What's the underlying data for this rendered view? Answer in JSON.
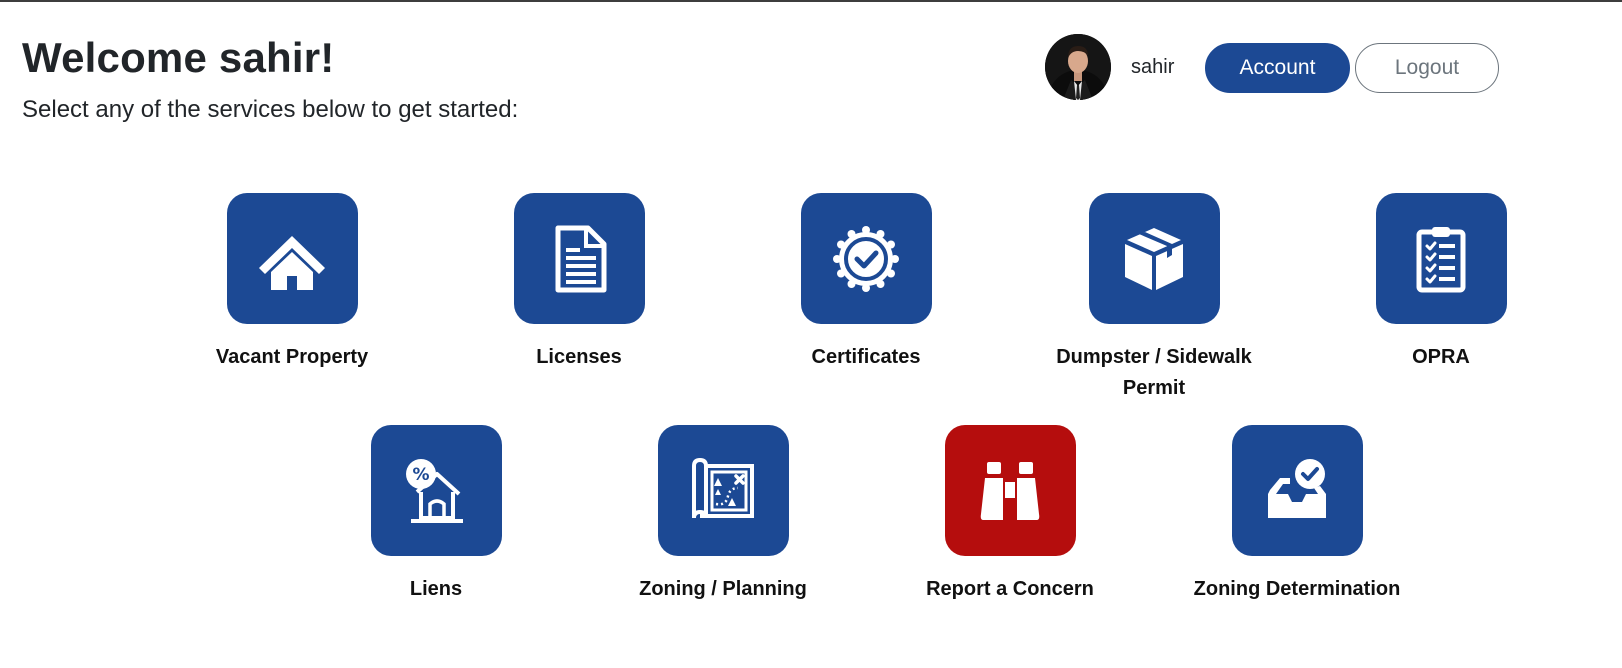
{
  "header": {
    "title": "Welcome sahir!",
    "subtitle": "Select any of the services below to get started:"
  },
  "user": {
    "name": "sahir",
    "avatar_icon": "user-avatar-photo"
  },
  "buttons": {
    "account_label": "Account",
    "logout_label": "Logout"
  },
  "colors": {
    "primary": "#1c4994",
    "alert": "#b50d0d"
  },
  "services": [
    {
      "label": "Vacant Property",
      "icon": "house-icon"
    },
    {
      "label": "Licenses",
      "icon": "document-icon"
    },
    {
      "label": "Certificates",
      "icon": "certificate-badge-icon"
    },
    {
      "label": "Dumpster / Sidewalk Permit",
      "icon": "box-icon"
    },
    {
      "label": "OPRA",
      "icon": "clipboard-checklist-icon"
    },
    {
      "label": "Liens",
      "icon": "house-percent-icon"
    },
    {
      "label": "Zoning / Planning",
      "icon": "map-icon"
    },
    {
      "label": "Report a Concern",
      "icon": "binoculars-icon"
    },
    {
      "label": "Zoning Determination",
      "icon": "inbox-check-icon"
    }
  ]
}
